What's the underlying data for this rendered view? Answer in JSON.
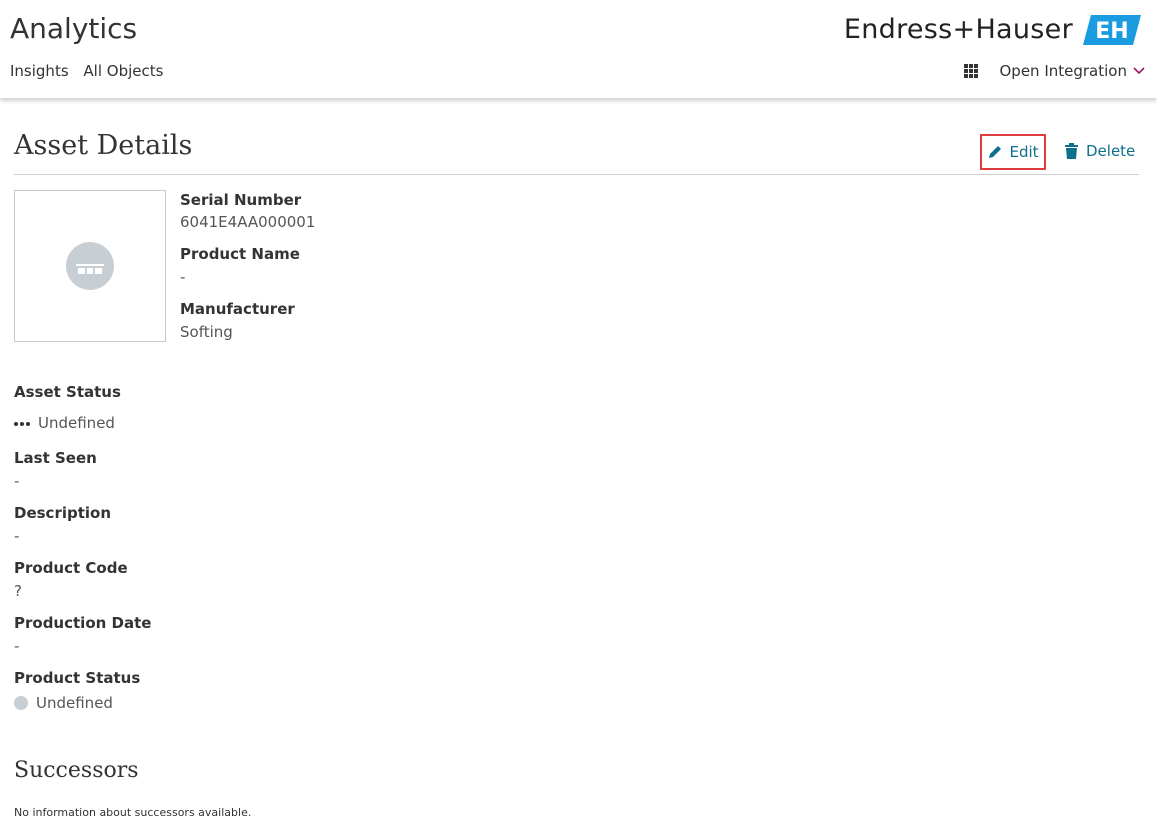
{
  "header": {
    "app_title": "Analytics",
    "nav": [
      "Insights",
      "All Objects"
    ],
    "brand": "Endress+Hauser",
    "integration_label": "Open Integration"
  },
  "page": {
    "title": "Asset Details",
    "edit_label": "Edit",
    "delete_label": "Delete"
  },
  "asset": {
    "serial_number_label": "Serial Number",
    "serial_number": "6041E4AA000001",
    "product_name_label": "Product Name",
    "product_name": "-",
    "manufacturer_label": "Manufacturer",
    "manufacturer": "Softing"
  },
  "details": {
    "asset_status_label": "Asset Status",
    "asset_status": "Undefined",
    "last_seen_label": "Last Seen",
    "last_seen": "-",
    "description_label": "Description",
    "description": "-",
    "product_code_label": "Product Code",
    "product_code": "?",
    "production_date_label": "Production Date",
    "production_date": "-",
    "product_status_label": "Product Status",
    "product_status": "Undefined"
  },
  "successors": {
    "title": "Successors",
    "note": "No information about successors available."
  },
  "colors": {
    "accent": "#0e6f8f",
    "highlight": "#e03c3c",
    "logo_blue": "#1b9be0",
    "status_grey": "#c7ced4"
  },
  "icons": {
    "edit": "pencil-icon",
    "delete": "trash-icon",
    "apps": "grid-icon",
    "dropdown": "chevron-down-icon",
    "asset_placeholder": "device-placeholder-icon"
  }
}
